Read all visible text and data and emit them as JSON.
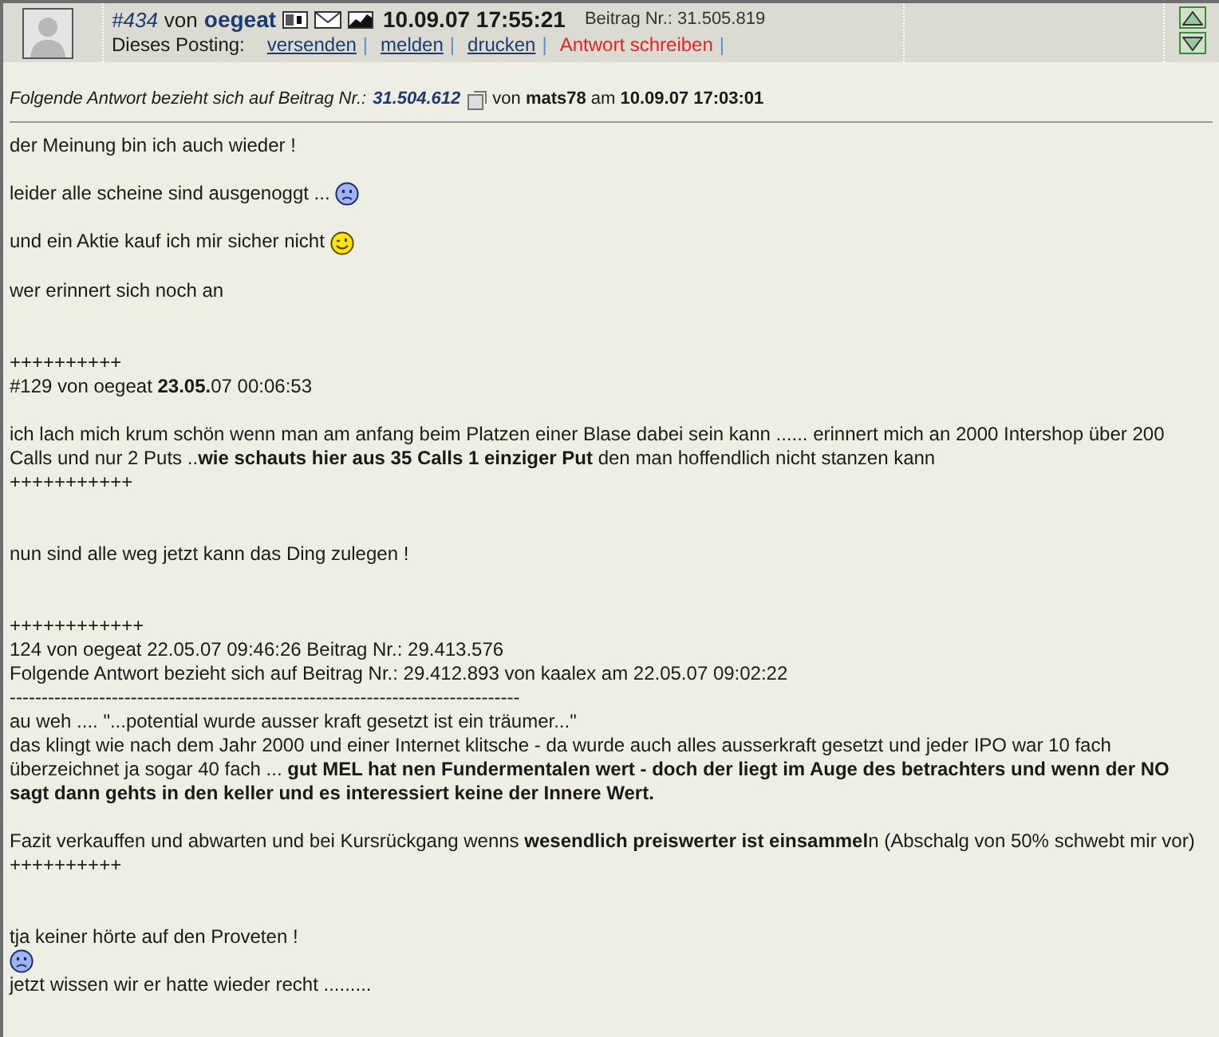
{
  "post": {
    "number": "#434",
    "by": "von",
    "author": "oegeat",
    "timestamp": "10.09.07 17:55:21",
    "post_id_label": "Beitrag Nr.: 31.505.819",
    "actions_label": "Dieses Posting:",
    "actions": [
      {
        "label": "versenden",
        "kind": "link"
      },
      {
        "label": "melden",
        "kind": "link"
      },
      {
        "label": "drucken",
        "kind": "link"
      },
      {
        "label": "Antwort schreiben",
        "kind": "reply"
      }
    ],
    "separator": "|"
  },
  "quote": {
    "prefix": "Folgende Antwort bezieht sich auf Beitrag Nr.:",
    "post_number": "31.504.612",
    "rest": "von **mats78** am **10.09.07 17:03:01**"
  },
  "body": [
    {
      "kind": "text",
      "text": "der Meinung bin ich auch wieder !"
    },
    {
      "kind": "blank"
    },
    {
      "kind": "text",
      "text": "leider alle scheine sind ausgenoggt ...",
      "emoticon": {
        "kind": "sad"
      }
    },
    {
      "kind": "blank"
    },
    {
      "kind": "text",
      "text": "und ein Aktie kauf ich mir sicher nicht",
      "emoticon": {
        "kind": "wink"
      }
    },
    {
      "kind": "blank"
    },
    {
      "kind": "text",
      "text": "wer erinnert sich noch an"
    },
    {
      "kind": "blank"
    },
    {
      "kind": "blank"
    },
    {
      "kind": "text",
      "text": "++++++++++"
    },
    {
      "kind": "text",
      "text": "#129 von oegeat **23.05.**07 00:06:53"
    },
    {
      "kind": "blank"
    },
    {
      "kind": "text",
      "text": "ich lach mich krum schön wenn man am anfang beim Platzen einer Blase dabei sein kann ...... erinnert mich an 2000 Intershop über 200 Calls und nur 2 Puts ..**wie schauts hier aus 35 Calls 1 einziger Put** den man hoffendlich nicht stanzen kann"
    },
    {
      "kind": "text",
      "text": "+++++++++++"
    },
    {
      "kind": "blank"
    },
    {
      "kind": "blank"
    },
    {
      "kind": "text",
      "text": "nun sind alle weg jetzt kann das Ding zulegen !"
    },
    {
      "kind": "blank"
    },
    {
      "kind": "blank"
    },
    {
      "kind": "text",
      "text": "++++++++++++"
    },
    {
      "kind": "text",
      "text": "124 von oegeat 22.05.07 09:46:26 Beitrag Nr.: 29.413.576"
    },
    {
      "kind": "text",
      "text": "Folgende Antwort bezieht sich auf Beitrag Nr.: 29.412.893 von kaalex am 22.05.07 09:02:22"
    },
    {
      "kind": "text",
      "text": "--------------------------------------------------------------------------------"
    },
    {
      "kind": "text",
      "text": "au weh .... \"...potential wurde ausser kraft gesetzt ist ein träumer...\""
    },
    {
      "kind": "text",
      "text": "das klingt wie nach dem Jahr 2000 und einer Internet klitsche - da wurde auch alles ausserkraft gesetzt und jeder IPO war 10 fach überzeichnet ja sogar 40 fach ... **gut MEL hat nen Fundermentalen wert - doch der liegt im Auge des betrachters und wenn der NO sagt dann gehts in den keller und es interessiert keine der Innere Wert.**"
    },
    {
      "kind": "blank"
    },
    {
      "kind": "text",
      "text": "Fazit verkauffen und abwarten und bei Kursrückgang wenns **wesendlich preiswerter ist einsammel**n (Abschalg von 50% schwebt mir vor)"
    },
    {
      "kind": "text",
      "text": "++++++++++"
    },
    {
      "kind": "blank"
    },
    {
      "kind": "blank"
    },
    {
      "kind": "text",
      "text": "tja keiner hörte auf den Proveten !"
    },
    {
      "kind": "emoticon",
      "emoticon": {
        "kind": "sad"
      }
    },
    {
      "kind": "text",
      "text": "jetzt wissen wir er hatte wieder recht ........."
    }
  ]
}
